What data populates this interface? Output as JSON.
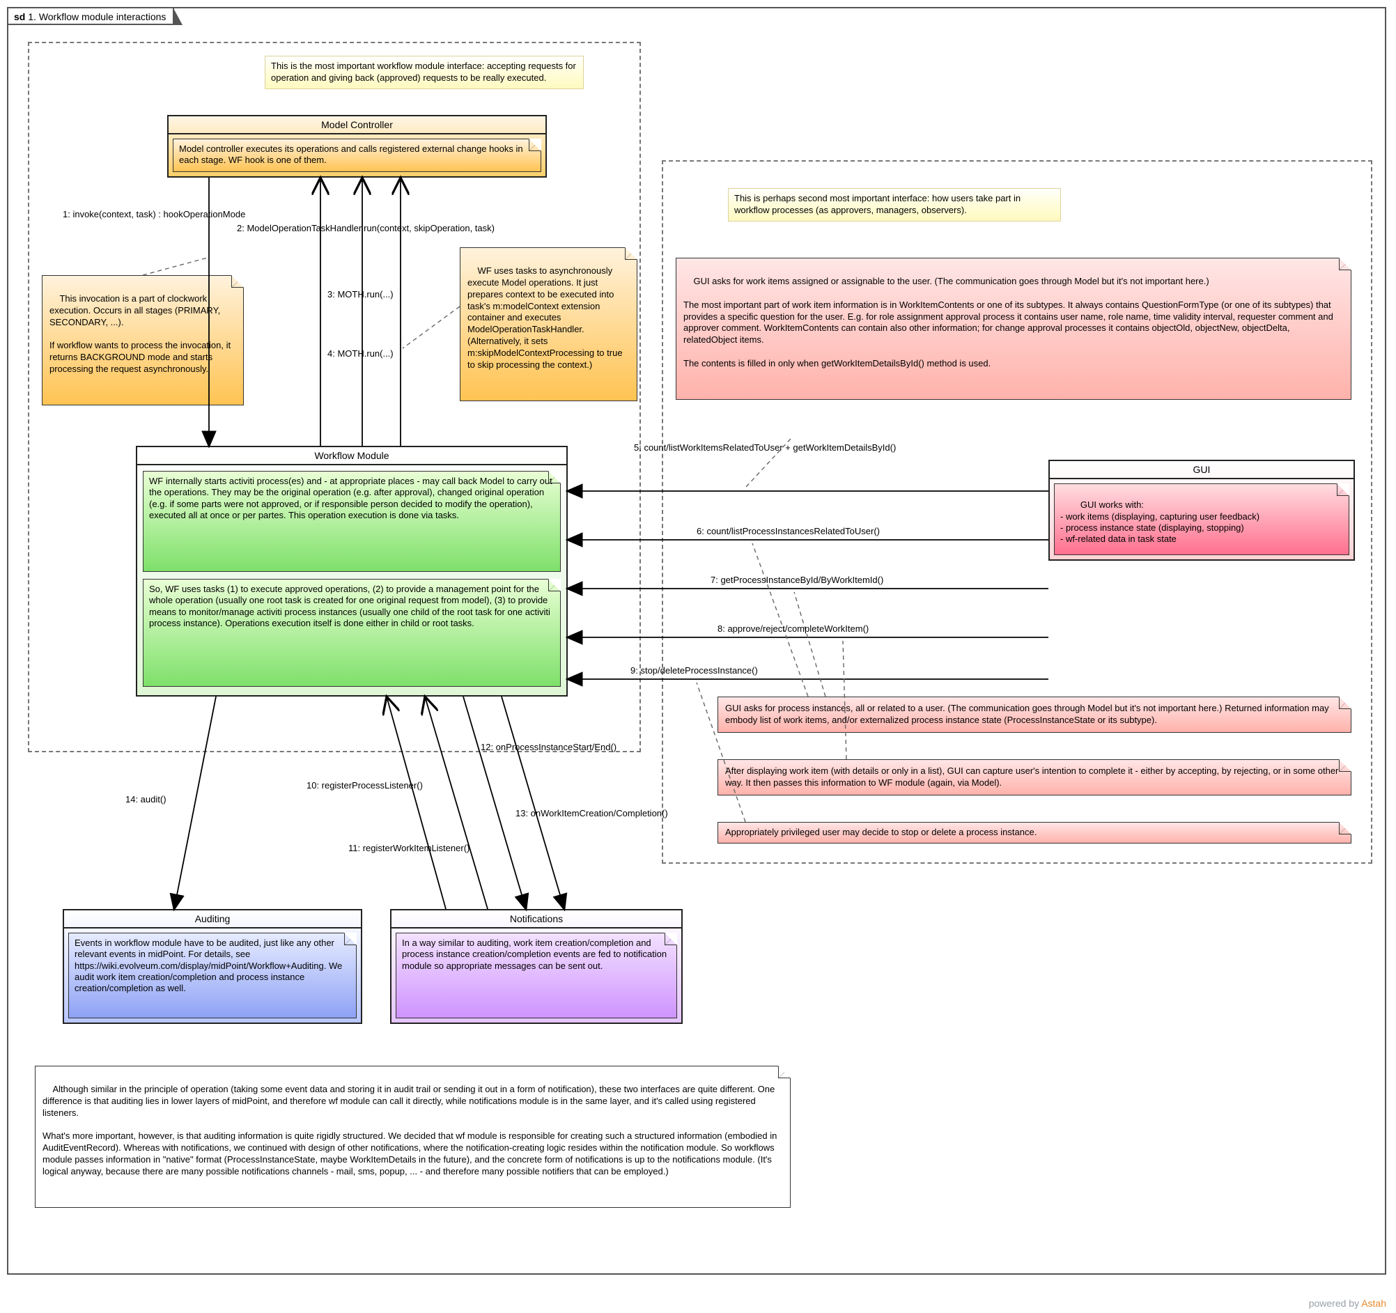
{
  "title_prefix": "sd",
  "title_index": "1.",
  "title_text": "Workflow module interactions",
  "sticky_left": "This is the most important workflow module interface: accepting requests for operation and giving back (approved) requests to be really executed.",
  "sticky_right": "This is perhaps second most important interface: how users take part in workflow processes (as approvers, managers, observers).",
  "model_controller_title": "Model Controller",
  "model_controller_note": "Model controller executes its operations and calls registered external change hooks in each stage. WF hook is one of them.",
  "wf_title": "Workflow Module",
  "wf_note1": "WF internally starts activiti process(es) and - at appropriate places - may call back Model to carry out the operations. They may be the original operation (e.g. after approval), changed original operation (e.g. if some parts were not approved, or if responsible person decided to modify the operation), executed all at once or per partes. This operation execution is done via tasks.",
  "wf_note2": "So, WF uses tasks (1) to execute approved operations, (2) to provide a management point for the whole operation (usually one root task is created for one original request from model), (3) to provide means to monitor/manage activiti process instances (usually one child of the root task for one activiti process instance). Operations execution itself is done either in child or root tasks.",
  "gui_title": "GUI",
  "gui_note": "GUI works with:\n- work items (displaying, capturing user feedback)\n- process instance state (displaying, stopping)\n- wf-related data in task state",
  "auditing_title": "Auditing",
  "auditing_note": "Events in workflow module have to be audited, just like any other relevant events in midPoint. For details, see https://wiki.evolveum.com/display/midPoint/Workflow+Auditing. We audit work item creation/completion and process instance creation/completion as well.",
  "notifications_title": "Notifications",
  "notifications_note": "In a way similar to auditing, work item creation/completion and process instance creation/completion events are fed to notification module so appropriate messages can be sent out.",
  "note_invoke": "This invocation is a part of clockwork execution. Occurs in all stages (PRIMARY, SECONDARY, ...).\n\nIf workflow wants to process the invocation, it returns BACKGROUND mode and starts processing the request asynchronously.",
  "note_wftasks": "WF uses tasks to asynchronously execute Model operations. It just prepares context to be executed into task's m:modelContext extension container and executes ModelOperationTaskHandler. (Alternatively, it sets m:skipModelContextProcessing to true to skip processing the context.)",
  "note_gui_big": "GUI asks for work items assigned or assignable to the user. (The communication goes through Model but it's not important here.)\n\nThe most important part of work item information is in WorkItemContents or one of its subtypes. It always contains QuestionFormType (or one of its subtypes) that provides a specific question for the user. E.g. for role assignment approval process it contains user name, role name, time validity interval, requester comment and approver comment. WorkItemContents can contain also other information; for change approval processes it contains objectOld, objectNew, objectDelta, relatedObject items.\n\nThe contents is filled in only when getWorkItemDetailsById() method is used.",
  "note_gui_procinst": "GUI asks for process instances, all or related to a user. (The communication goes through Model but it's not important here.) Returned information may embody list of work items, and/or externalized process instance state (ProcessInstanceState or its subtype).",
  "note_gui_complete": "After displaying work item (with details or only in a list), GUI can capture user's intention to complete it - either by accepting, by rejecting, or in some other way. It then passes this information to WF module (again, via Model).",
  "note_gui_stop": "Appropriately privileged user may decide to stop or delete a process instance.",
  "note_bottom": "Although similar in the principle of operation (taking some event data and storing it in audit trail or sending it out in a form of notification), these two interfaces are quite different. One difference is that auditing lies in lower layers of midPoint, and therefore wf module can call it directly, while notifications module is in the same layer, and it's called using registered listeners.\n\nWhat's more important, however, is that auditing information is quite rigidly structured. We decided that wf module is responsible for creating such a structured information (embodied in AuditEventRecord). Whereas with notifications, we continued with design of other notifications, where the notification-creating logic resides within the notification module. So workflows module passes information in \"native\" format (ProcessInstanceState, maybe WorkItemDetails in the future), and the concrete form of notifications is up to the notifications module. (It's logical anyway, because there are many possible notifications channels - mail, sms, popup, ... - and therefore many possible notifiers that can be employed.)",
  "messages": {
    "m1": "1: invoke(context, task) : hookOperationMode",
    "m2": "2: ModelOperationTaskHandler.run(context, skipOperation, task)",
    "m3": "3: MOTH.run(...)",
    "m4": "4: MOTH.run(...)",
    "m5": "5: count/listWorkItemsRelatedToUser + getWorkItemDetailsById()",
    "m6": "6: count/listProcessInstancesRelatedToUser()",
    "m7": "7: getProcessInstanceById/ByWorkItemId()",
    "m8": "8: approve/reject/completeWorkItem()",
    "m9": "9: stop/deleteProcessInstance()",
    "m10": "10: registerProcessListener()",
    "m11": "11: registerWorkItemListener()",
    "m12": "12: onProcessInstanceStart/End()",
    "m13": "13: onWorkItemCreation/Completion()",
    "m14": "14: audit()"
  },
  "footer_prefix": "powered by ",
  "footer_brand": "Astah",
  "footer_suffix": ""
}
